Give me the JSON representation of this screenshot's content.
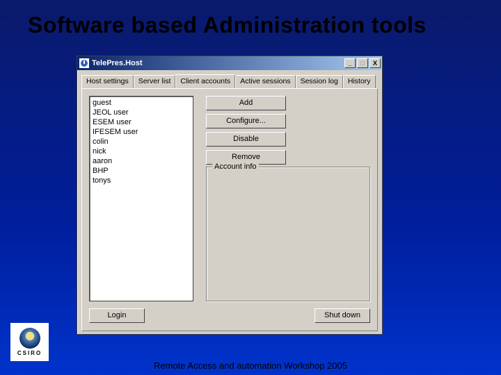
{
  "slide": {
    "title": "Software based Administration tools",
    "footer": "Remote Access and automation Workshop 2005",
    "logo_text": "CSIRO"
  },
  "window": {
    "title": "TelePres.Host",
    "controls": {
      "min": "_",
      "max": "□",
      "close": "X"
    },
    "tabs": [
      {
        "label": "Host settings",
        "active": false
      },
      {
        "label": "Server list",
        "active": false
      },
      {
        "label": "Client accounts",
        "active": true
      },
      {
        "label": "Active sessions",
        "active": false
      },
      {
        "label": "Session log",
        "active": false
      },
      {
        "label": "History",
        "active": false
      }
    ],
    "accounts": [
      "guest",
      "JEOL user",
      "ESEM user",
      "IFESEM user",
      "colin",
      "nick",
      "aaron",
      "BHP",
      "tonys"
    ],
    "buttons": {
      "add": "Add",
      "configure": "Configure...",
      "disable": "Disable",
      "remove": "Remove",
      "login": "Login",
      "shutdown": "Shut down"
    },
    "group": {
      "label": "Account info"
    }
  }
}
